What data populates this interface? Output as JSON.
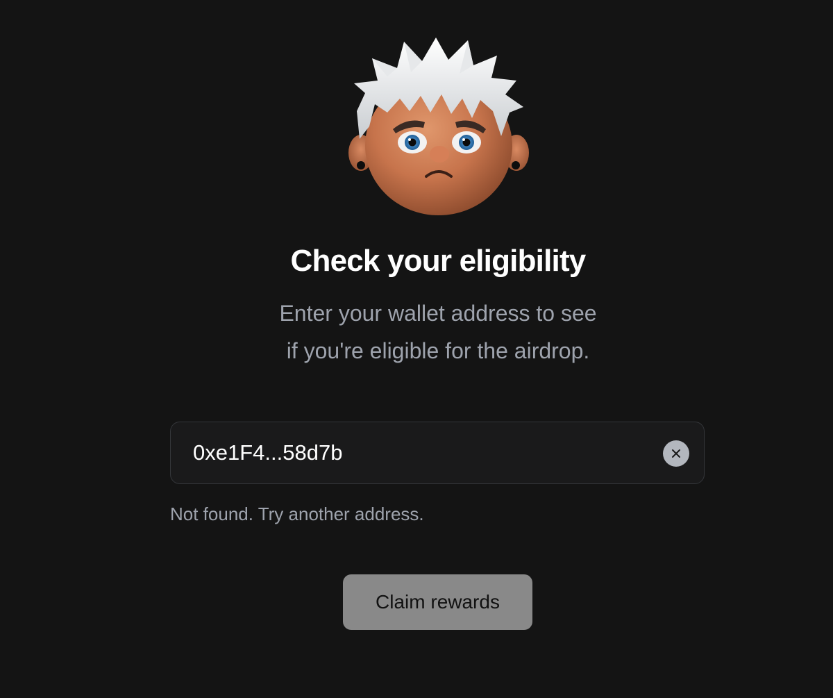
{
  "hero": {
    "avatar_icon": "sad-character-avatar"
  },
  "heading": {
    "title": "Check your eligibility",
    "subtitle_line1": "Enter your wallet address to see",
    "subtitle_line2": "if you're eligible for the airdrop."
  },
  "wallet": {
    "value": "0xe1F4...58d7b",
    "clear_icon": "close-icon"
  },
  "status": {
    "message": "Not found. Try another address."
  },
  "actions": {
    "claim_label": "Claim rewards"
  },
  "colors": {
    "background": "#141414",
    "title": "#ffffff",
    "muted_text": "#9ea3ad",
    "field_border": "#34363a",
    "button_disabled": "#898989"
  }
}
